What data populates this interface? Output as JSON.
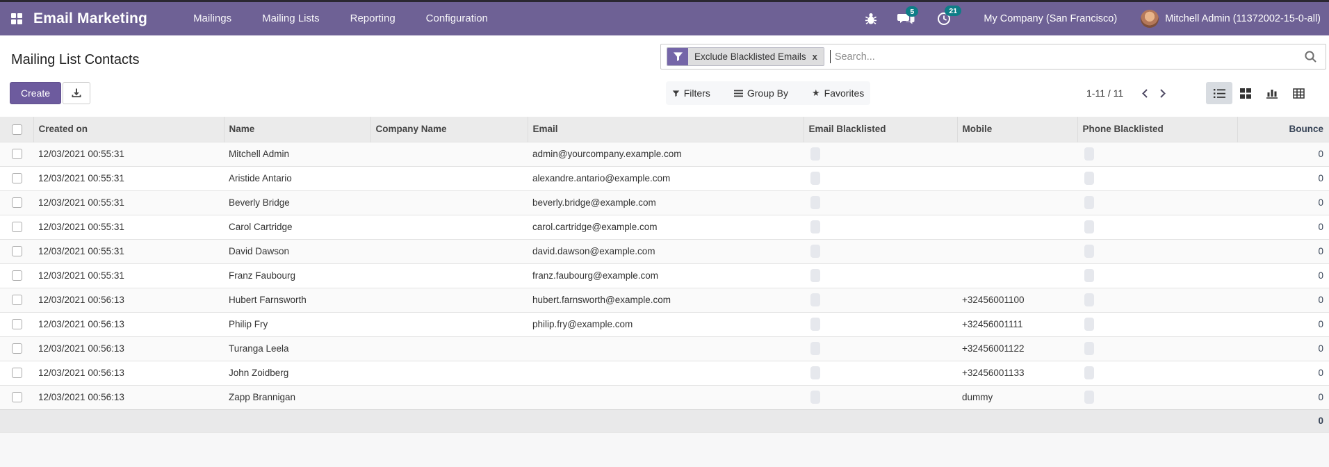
{
  "topbar": {
    "app_name": "Email Marketing",
    "menus": [
      "Mailings",
      "Mailing Lists",
      "Reporting",
      "Configuration"
    ],
    "messages_badge": "5",
    "activities_badge": "21",
    "company": "My Company (San Francisco)",
    "user": "Mitchell Admin (11372002-15-0-all)"
  },
  "page": {
    "title": "Mailing List Contacts"
  },
  "actions": {
    "create_label": "Create"
  },
  "search": {
    "facet_label": "Exclude Blacklisted Emails",
    "facet_remove": "x",
    "placeholder": "Search...",
    "filters_label": "Filters",
    "group_by_label": "Group By",
    "favorites_label": "Favorites"
  },
  "pager": {
    "range": "1-11 / 11"
  },
  "table": {
    "columns": [
      "Created on",
      "Name",
      "Company Name",
      "Email",
      "Email Blacklisted",
      "Mobile",
      "Phone Blacklisted",
      "Bounce"
    ],
    "rows": [
      {
        "created_on": "12/03/2021 00:55:31",
        "name": "Mitchell Admin",
        "company": "",
        "email": "admin@yourcompany.example.com",
        "mobile": "",
        "bounce": "0"
      },
      {
        "created_on": "12/03/2021 00:55:31",
        "name": "Aristide Antario",
        "company": "",
        "email": "alexandre.antario@example.com",
        "mobile": "",
        "bounce": "0"
      },
      {
        "created_on": "12/03/2021 00:55:31",
        "name": "Beverly Bridge",
        "company": "",
        "email": "beverly.bridge@example.com",
        "mobile": "",
        "bounce": "0"
      },
      {
        "created_on": "12/03/2021 00:55:31",
        "name": "Carol Cartridge",
        "company": "",
        "email": "carol.cartridge@example.com",
        "mobile": "",
        "bounce": "0"
      },
      {
        "created_on": "12/03/2021 00:55:31",
        "name": "David Dawson",
        "company": "",
        "email": "david.dawson@example.com",
        "mobile": "",
        "bounce": "0"
      },
      {
        "created_on": "12/03/2021 00:55:31",
        "name": "Franz Faubourg",
        "company": "",
        "email": "franz.faubourg@example.com",
        "mobile": "",
        "bounce": "0"
      },
      {
        "created_on": "12/03/2021 00:56:13",
        "name": "Hubert Farnsworth",
        "company": "",
        "email": "hubert.farnsworth@example.com",
        "mobile": "+32456001100",
        "bounce": "0"
      },
      {
        "created_on": "12/03/2021 00:56:13",
        "name": "Philip Fry",
        "company": "",
        "email": "philip.fry@example.com",
        "mobile": "+32456001111",
        "bounce": "0"
      },
      {
        "created_on": "12/03/2021 00:56:13",
        "name": "Turanga Leela",
        "company": "",
        "email": "",
        "mobile": "+32456001122",
        "bounce": "0"
      },
      {
        "created_on": "12/03/2021 00:56:13",
        "name": "John Zoidberg",
        "company": "",
        "email": "",
        "mobile": "+32456001133",
        "bounce": "0"
      },
      {
        "created_on": "12/03/2021 00:56:13",
        "name": "Zapp Brannigan",
        "company": "",
        "email": "",
        "mobile": "dummy",
        "bounce": "0"
      }
    ],
    "footer": {
      "bounce_total": "0"
    }
  },
  "colors": {
    "navbar": "#6e6195",
    "primary_button": "#6d5b9e",
    "facet_icon": "#7566a8",
    "badge": "#0e7d87",
    "header_bg": "#ebebeb"
  }
}
